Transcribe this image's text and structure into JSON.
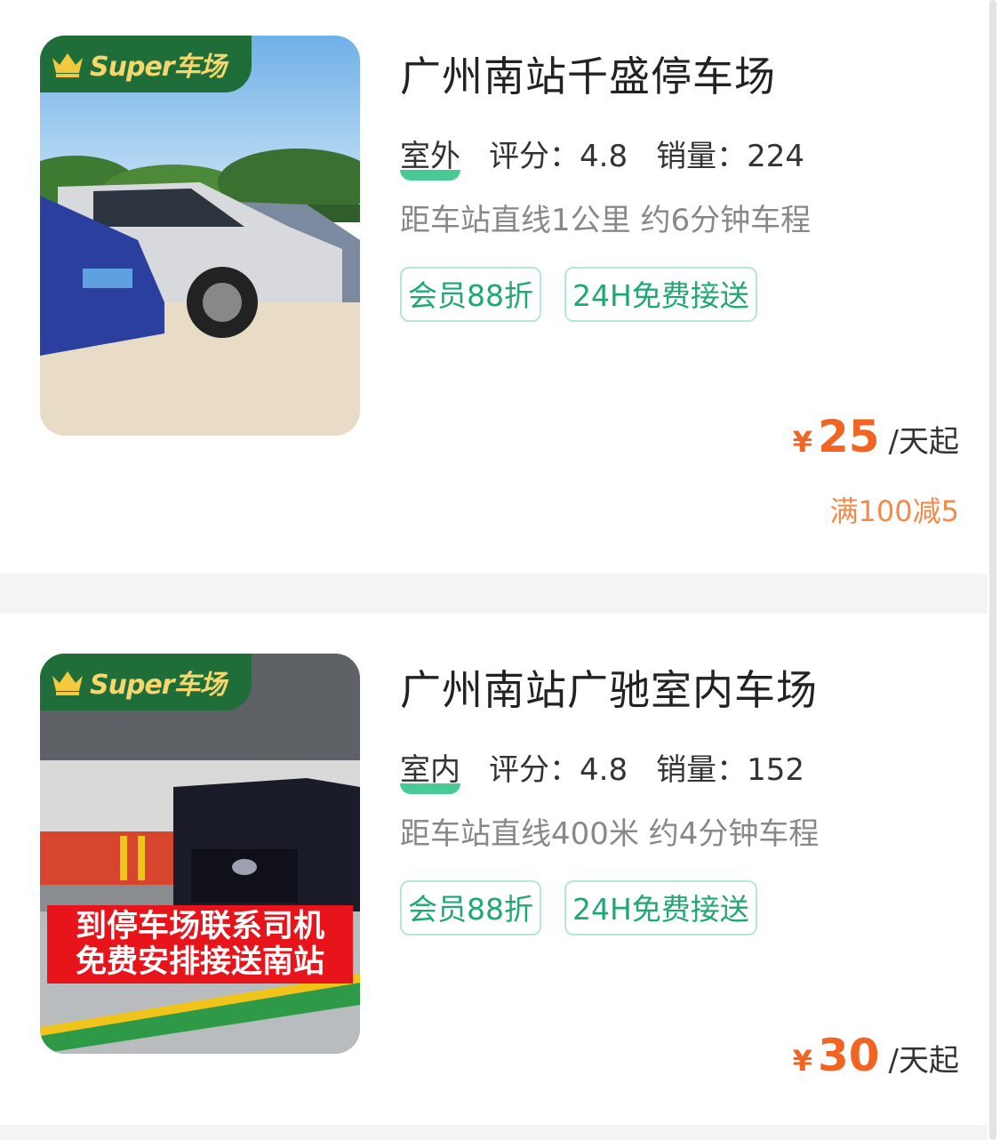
{
  "listings": [
    {
      "badge": "Super车场",
      "title": "广州南站千盛停车场",
      "environment": "室外",
      "rating_text": "评分：4.8",
      "sales_text": "销量：224",
      "distance": "距车站直线1公里 约6分钟车程",
      "tags": [
        "会员88折",
        "24H免费接送"
      ],
      "currency": "¥",
      "price": "25",
      "price_unit": "/天起",
      "discount": "满100减5"
    },
    {
      "badge": "Super车场",
      "title": "广州南站广驰室内车场",
      "environment": "室内",
      "rating_text": "评分：4.8",
      "sales_text": "销量：152",
      "distance": "距车站直线400米 约4分钟车程",
      "tags": [
        "会员88折",
        "24H免费接送"
      ],
      "currency": "¥",
      "price": "30",
      "price_unit": "/天起",
      "photo_overlay": [
        "到停车场联系司机",
        "免费安排接送南站"
      ]
    }
  ],
  "colors": {
    "badge_bg": "#1f6e3a",
    "badge_text": "#f5d76e",
    "tag_green": "#1fa874",
    "price_orange": "#f26422",
    "discount_orange": "#f28a4a"
  },
  "icons": {
    "badge_icon": "crown-icon"
  }
}
